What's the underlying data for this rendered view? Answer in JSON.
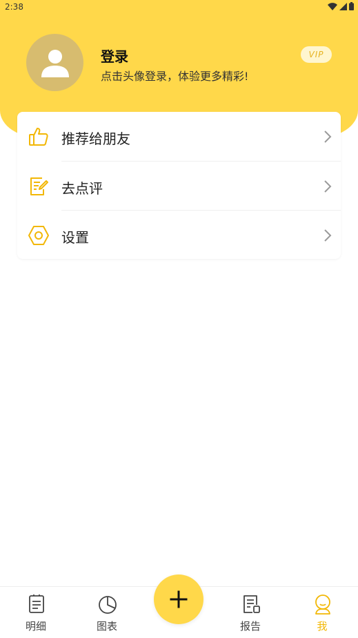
{
  "status_bar": {
    "time": "2:38"
  },
  "profile": {
    "title": "登录",
    "subtitle": "点击头像登录，体验更多精彩!",
    "vip_label": "VIP"
  },
  "menu": {
    "items": [
      {
        "label": "推荐给朋友",
        "icon": "thumbs-up-icon"
      },
      {
        "label": "去点评",
        "icon": "edit-note-icon"
      },
      {
        "label": "设置",
        "icon": "hex-settings-icon"
      }
    ]
  },
  "tabbar": {
    "tabs": [
      {
        "label": "明细",
        "icon": "document-list-icon"
      },
      {
        "label": "图表",
        "icon": "pie-chart-icon"
      },
      {
        "label": "报告",
        "icon": "report-icon"
      },
      {
        "label": "我",
        "icon": "user-icon",
        "active": true
      }
    ],
    "add_icon": "plus-icon"
  },
  "colors": {
    "accent": "#FFD84A",
    "icon": "#F2B705",
    "avatar": "#D7BC6F"
  }
}
